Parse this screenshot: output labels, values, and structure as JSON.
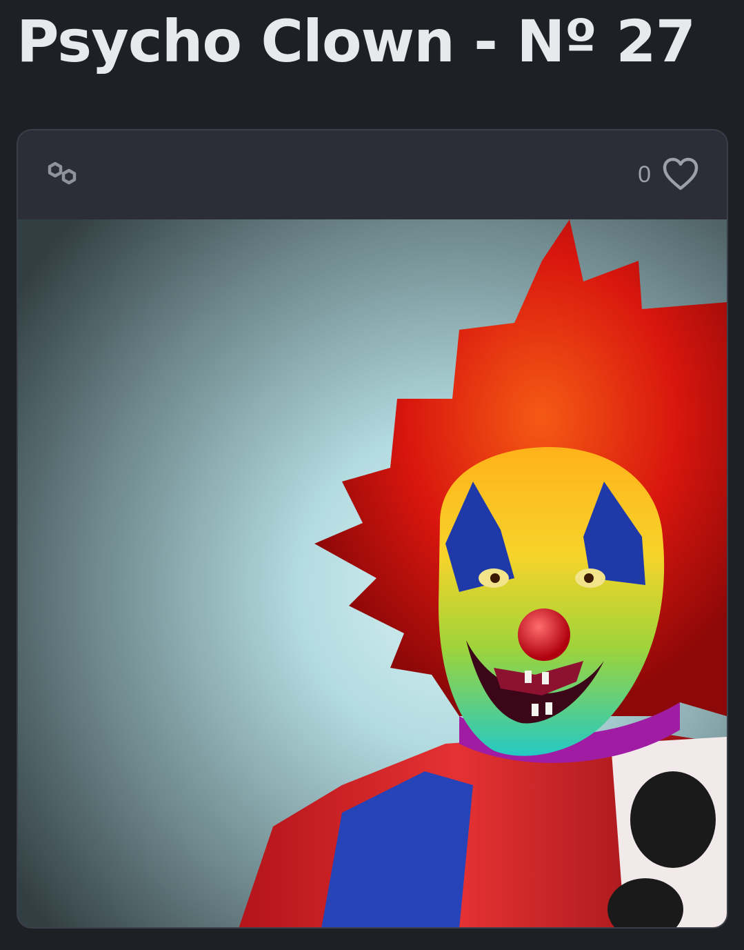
{
  "page": {
    "title": "Psycho Clown - Nº 27"
  },
  "card": {
    "chain_icon": "polygon-icon",
    "like_count": "0",
    "heart_icon": "heart-icon",
    "artwork": "nft-artwork-clown-image"
  },
  "colors": {
    "background": "#1f2025",
    "card": "#2b2e37",
    "title": "#e7e9ec",
    "muted": "#9ca0a8"
  }
}
